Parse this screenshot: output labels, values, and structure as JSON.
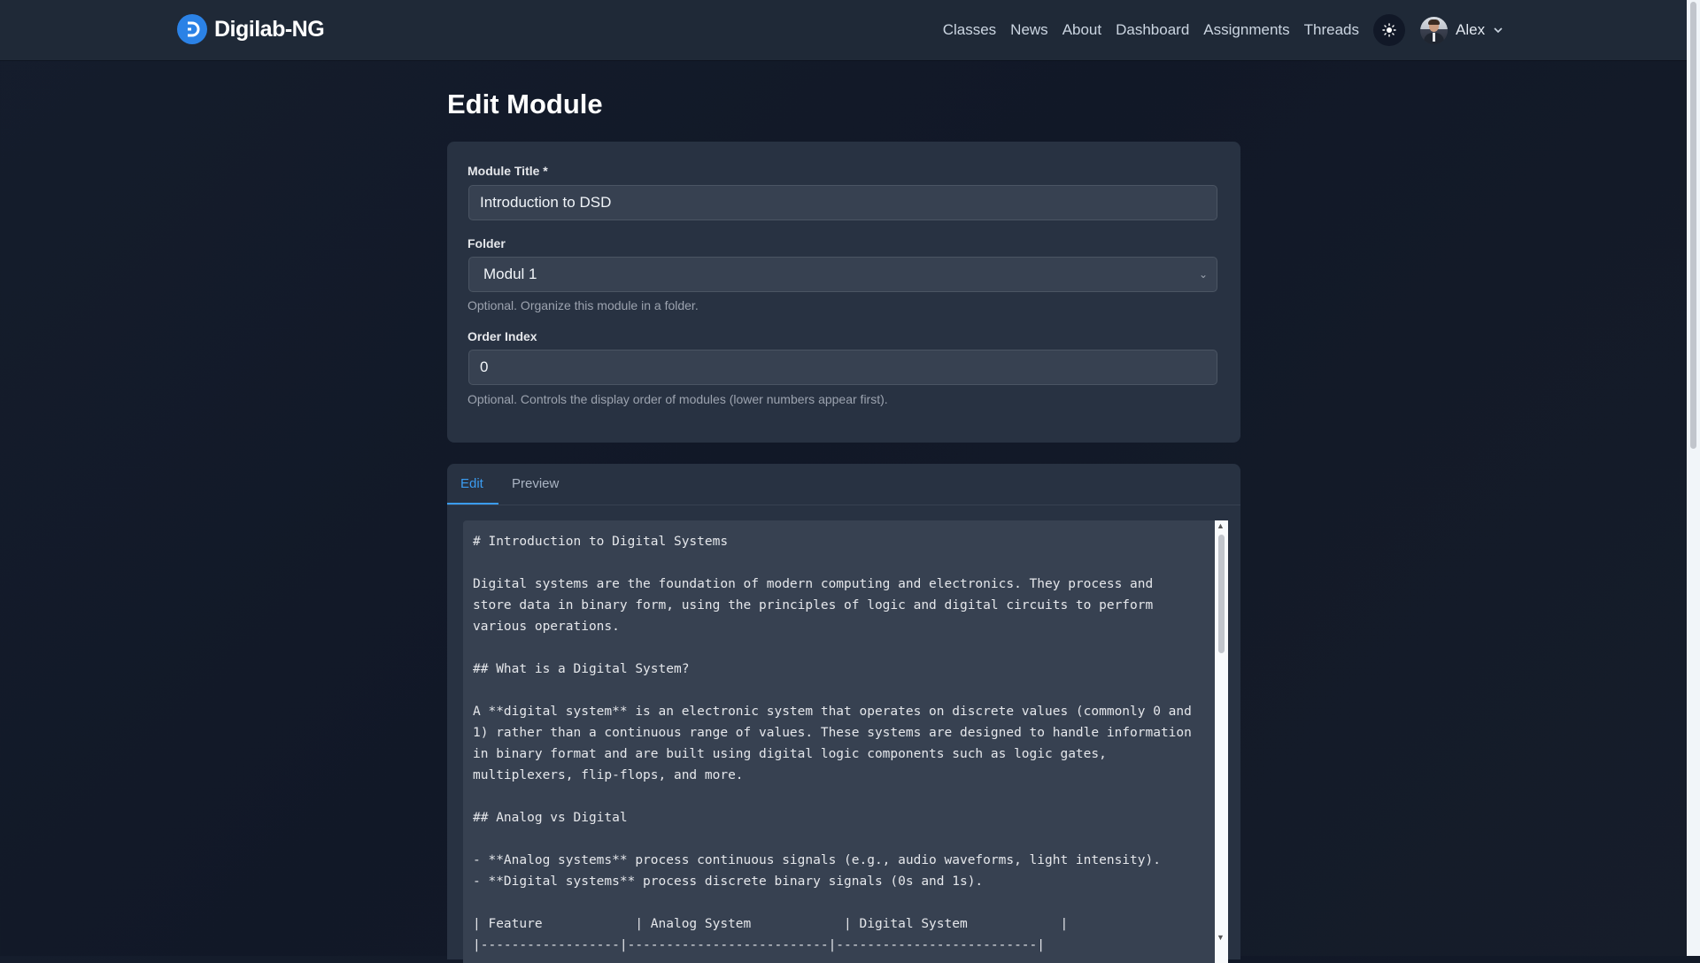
{
  "brand": {
    "name": "Digilab-NG"
  },
  "nav": {
    "links": [
      {
        "label": "Classes"
      },
      {
        "label": "News"
      },
      {
        "label": "About"
      },
      {
        "label": "Dashboard"
      },
      {
        "label": "Assignments"
      },
      {
        "label": "Threads"
      }
    ],
    "user_name": "Alex"
  },
  "page": {
    "title": "Edit Module"
  },
  "form": {
    "module_title_label": "Module Title *",
    "module_title_value": "Introduction to DSD",
    "folder_label": "Folder",
    "folder_value": "Modul 1",
    "folder_hint": "Optional. Organize this module in a folder.",
    "order_label": "Order Index",
    "order_value": "0",
    "order_hint": "Optional. Controls the display order of modules (lower numbers appear first)."
  },
  "editor": {
    "tabs": [
      {
        "label": "Edit"
      },
      {
        "label": "Preview"
      }
    ],
    "active_tab": "Edit",
    "content": "# Introduction to Digital Systems\n\nDigital systems are the foundation of modern computing and electronics. They process and\nstore data in binary form, using the principles of logic and digital circuits to perform\nvarious operations.\n\n## What is a Digital System?\n\nA **digital system** is an electronic system that operates on discrete values (commonly 0 and\n1) rather than a continuous range of values. These systems are designed to handle information\nin binary format and are built using digital logic components such as logic gates,\nmultiplexers, flip-flops, and more.\n\n## Analog vs Digital\n\n- **Analog systems** process continuous signals (e.g., audio waveforms, light intensity).\n- **Digital systems** process discrete binary signals (0s and 1s).\n\n| Feature            | Analog System            | Digital System            |\n|------------------|--------------------------|--------------------------|"
  },
  "colors": {
    "accent": "#3b9cf0",
    "navbar_bg": "#1f2937",
    "card_bg": "#283242",
    "input_bg": "#374151"
  }
}
